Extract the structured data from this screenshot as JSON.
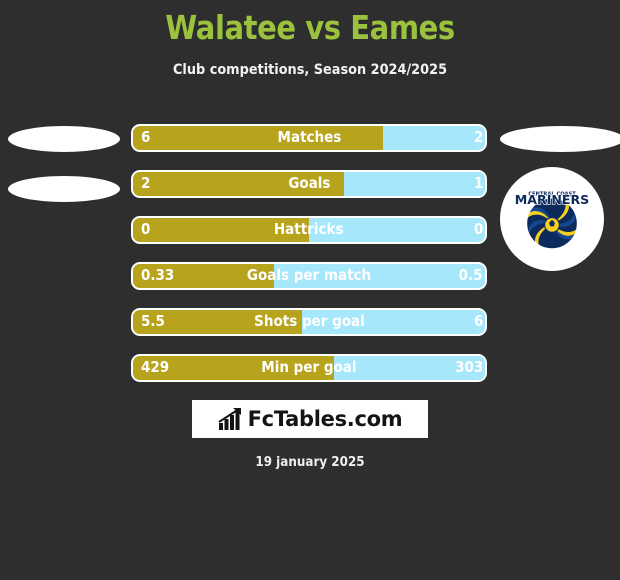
{
  "header": {
    "title": "Walatee vs Eames",
    "subtitle": "Club competitions, Season 2024/2025"
  },
  "footer": {
    "date": "19 january 2025",
    "brand": "FcTables.com",
    "brand_icon": "bar-chart-icon"
  },
  "colors": {
    "background": "#2e2e2e",
    "title": "#9ac23c",
    "home_bar": "#b8a41c",
    "away_bar": "#a6e7fb",
    "text": "#ffffff"
  },
  "teams": {
    "home": {
      "name": "Walatee",
      "crest": "blank-crest"
    },
    "away": {
      "name": "Eames",
      "crest": "central-coast-mariners-crest"
    }
  },
  "chart_data": {
    "type": "bar",
    "title": "Walatee vs Eames",
    "subtitle": "Club competitions, Season 2024/2025",
    "orientation": "horizontal-diverging",
    "categories": [
      "Matches",
      "Goals",
      "Hattricks",
      "Goals per match",
      "Shots per goal",
      "Min per goal"
    ],
    "series": [
      {
        "name": "Walatee",
        "color": "#b8a41c",
        "values": [
          "6",
          "2",
          "0",
          "0.33",
          "5.5",
          "429"
        ]
      },
      {
        "name": "Eames",
        "color": "#a6e7fb",
        "values": [
          "2",
          "1",
          "0",
          "0.5",
          "6",
          "303"
        ]
      }
    ],
    "rows": [
      {
        "label": "Matches",
        "home": "6",
        "away": "2",
        "home_pct": 71
      },
      {
        "label": "Goals",
        "home": "2",
        "away": "1",
        "home_pct": 60
      },
      {
        "label": "Hattricks",
        "home": "0",
        "away": "0",
        "home_pct": 50
      },
      {
        "label": "Goals per match",
        "home": "0.33",
        "away": "0.5",
        "home_pct": 40
      },
      {
        "label": "Shots per goal",
        "home": "5.5",
        "away": "6",
        "home_pct": 48
      },
      {
        "label": "Min per goal",
        "home": "429",
        "away": "303",
        "home_pct": 57
      }
    ],
    "grid": false,
    "legend": "none"
  }
}
